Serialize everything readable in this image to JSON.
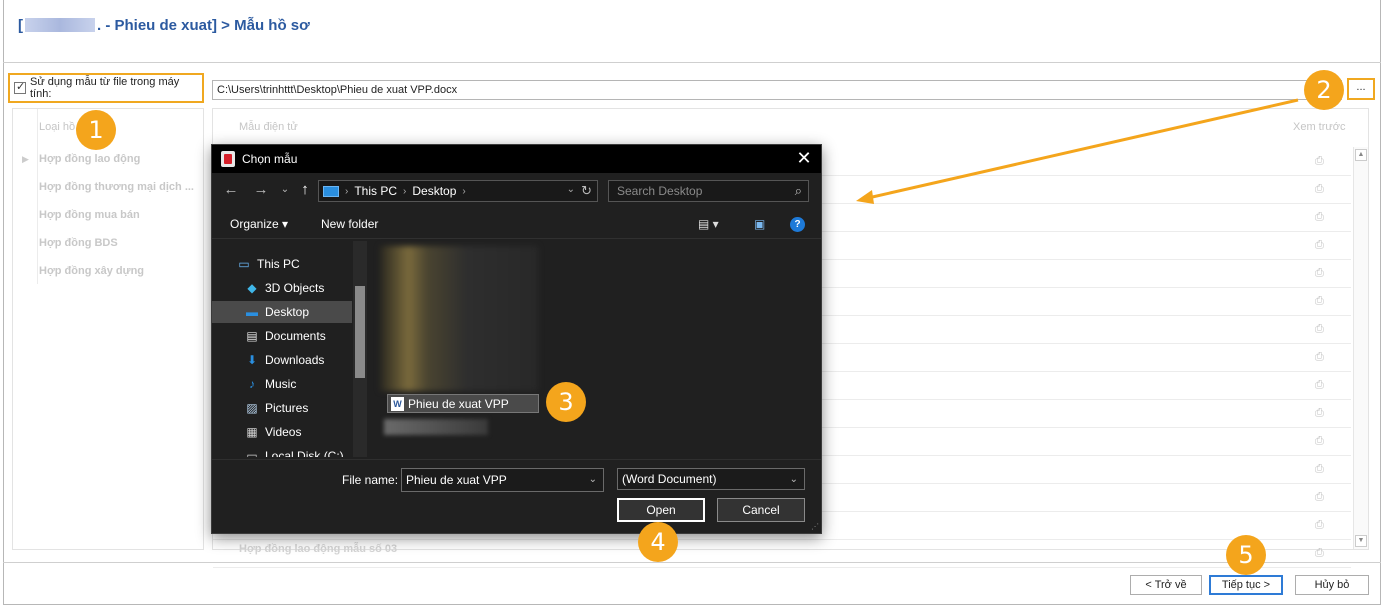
{
  "header": {
    "open_bracket": "[",
    "title_suffix": ". - Phieu de xuat] > Mẫu hồ sơ"
  },
  "use_file": {
    "label": "Sử dụng mẫu từ file trong máy tính:",
    "checked": true
  },
  "path": {
    "value": "C:\\Users\\trinhttt\\Desktop\\Phieu de xuat VPP.docx"
  },
  "browse_button": {
    "label": "..."
  },
  "left_grid": {
    "column_header": "Loại hồ",
    "rows": [
      "Hợp đồng lao động",
      "Hợp đồng thương mại dịch ...",
      "Hợp đồng mua bán",
      "Hợp đồng BDS",
      "Hợp đồng xây dựng"
    ]
  },
  "right_grid": {
    "column_header": "Mẫu điện tử",
    "preview_header": "Xem trước",
    "bottom_row": "Hợp đồng lao động mẫu số 03"
  },
  "footer": {
    "back_label": "< Trở về",
    "next_label": "Tiếp tục >",
    "cancel_label": "Hủy bỏ"
  },
  "badges": [
    "1",
    "2",
    "3",
    "4",
    "5"
  ],
  "dialog": {
    "title": "Chọn mẫu",
    "close": "✕",
    "address": {
      "crumb1": "This PC",
      "crumb2": "Desktop"
    },
    "search_placeholder": "Search Desktop",
    "toolbar": {
      "organize": "Organize",
      "new_folder": "New folder"
    },
    "nav_items": [
      {
        "label": "This PC",
        "icon": "computer-icon"
      },
      {
        "label": "3D Objects",
        "icon": "cube-icon"
      },
      {
        "label": "Desktop",
        "icon": "desktop-icon"
      },
      {
        "label": "Documents",
        "icon": "document-icon"
      },
      {
        "label": "Downloads",
        "icon": "download-icon"
      },
      {
        "label": "Music",
        "icon": "music-icon"
      },
      {
        "label": "Pictures",
        "icon": "picture-icon"
      },
      {
        "label": "Videos",
        "icon": "video-icon"
      },
      {
        "label": "Local Disk (C:)",
        "icon": "disk-icon"
      }
    ],
    "selected_file": "Phieu de xuat VPP",
    "file_name_label": "File name:",
    "file_name_value": "Phieu de xuat VPP",
    "file_type": "(Word Document)",
    "open_label": "Open",
    "cancel_label": "Cancel"
  },
  "colors": {
    "accent_orange": "#f4a51c",
    "title_blue": "#2c5aa0",
    "primary_blue": "#2e7bd6"
  }
}
